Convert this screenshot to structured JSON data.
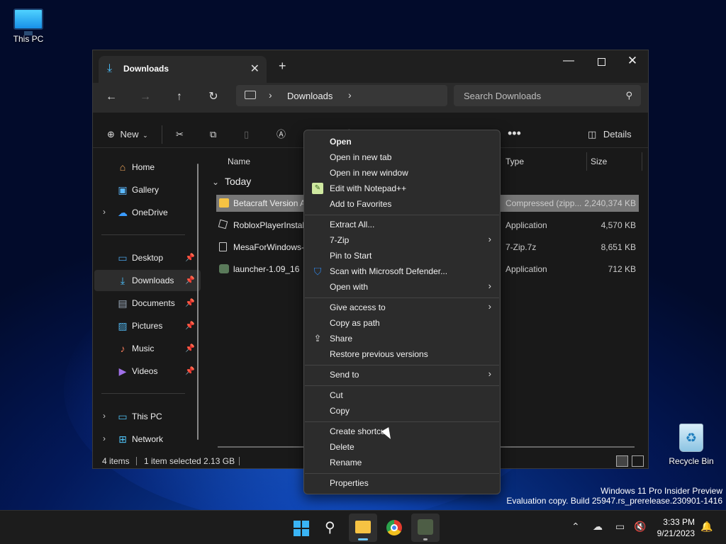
{
  "desktop": {
    "this_pc_label": "This PC",
    "recycle_bin_label": "Recycle Bin",
    "watermark_line1": "Windows 11 Pro Insider Preview",
    "watermark_line2": "Evaluation copy. Build 25947.rs_prerelease.230901-1416"
  },
  "explorer": {
    "tab_title": "Downloads",
    "address": {
      "location": "Downloads"
    },
    "search": {
      "placeholder": "Search Downloads"
    },
    "commands": {
      "new_label": "New",
      "details_label": "Details"
    },
    "sidebar": {
      "home": "Home",
      "gallery": "Gallery",
      "onedrive": "OneDrive",
      "desktop": "Desktop",
      "downloads": "Downloads",
      "documents": "Documents",
      "pictures": "Pictures",
      "music": "Music",
      "videos": "Videos",
      "this_pc": "This PC",
      "network": "Network"
    },
    "columns": {
      "name": "Name",
      "type": "Type",
      "size": "Size"
    },
    "group_label": "Today",
    "files": [
      {
        "name": "Betacraft Version A",
        "type": "Compressed (zipp...",
        "size": "2,240,374 KB"
      },
      {
        "name": "RobloxPlayerInstall",
        "type": "Application",
        "size": "4,570 KB"
      },
      {
        "name": "MesaForWindows-",
        "type": "7-Zip.7z",
        "size": "8,651 KB"
      },
      {
        "name": "launcher-1.09_16",
        "type": "Application",
        "size": "712 KB"
      }
    ],
    "status": {
      "items": "4 items",
      "selected": "1 item selected  2.13 GB"
    }
  },
  "context_menu": {
    "open": "Open",
    "open_new_tab": "Open in new tab",
    "open_new_window": "Open in new window",
    "edit_notepad": "Edit with Notepad++",
    "add_favorites": "Add to Favorites",
    "extract_all": "Extract All...",
    "seven_zip": "7-Zip",
    "pin_start": "Pin to Start",
    "scan_defender": "Scan with Microsoft Defender...",
    "open_with": "Open with",
    "give_access": "Give access to",
    "copy_path": "Copy as path",
    "share": "Share",
    "restore_versions": "Restore previous versions",
    "send_to": "Send to",
    "cut": "Cut",
    "copy": "Copy",
    "create_shortcut": "Create shortcut",
    "delete": "Delete",
    "rename": "Rename",
    "properties": "Properties"
  },
  "taskbar": {
    "time": "3:33 PM",
    "date": "9/21/2023"
  },
  "colors": {
    "accent": "#4cc2ff",
    "folder": "#f6c343",
    "selection": "#777777"
  }
}
